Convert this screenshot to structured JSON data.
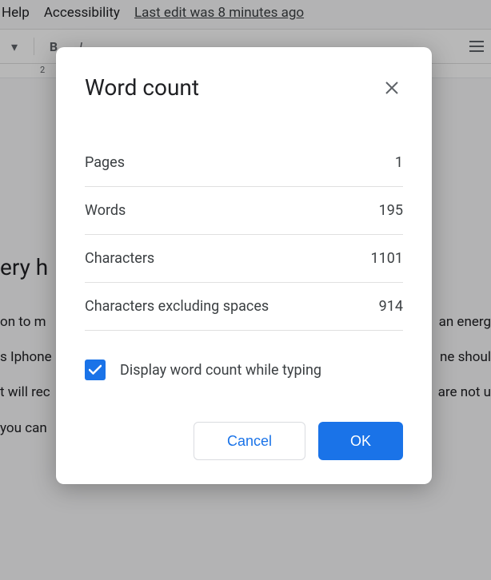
{
  "menubar": {
    "help": "Help",
    "accessibility": "Accessibility",
    "last_edit": "Last edit was 8 minutes ago"
  },
  "ruler": {
    "mark2": "2"
  },
  "document": {
    "heading_fragment": "ery h",
    "line1": "on to m",
    "line1b": "an energ",
    "line2": "s Iphone",
    "line2b": "ne shoul",
    "line3": "t will rec",
    "line3b": "are not u",
    "line4": "you can"
  },
  "dialog": {
    "title": "Word count",
    "stats": {
      "pages_label": "Pages",
      "pages_value": "1",
      "words_label": "Words",
      "words_value": "195",
      "chars_label": "Characters",
      "chars_value": "1101",
      "chars_ns_label": "Characters excluding spaces",
      "chars_ns_value": "914"
    },
    "option_label": "Display word count while typing",
    "cancel": "Cancel",
    "ok": "OK"
  }
}
